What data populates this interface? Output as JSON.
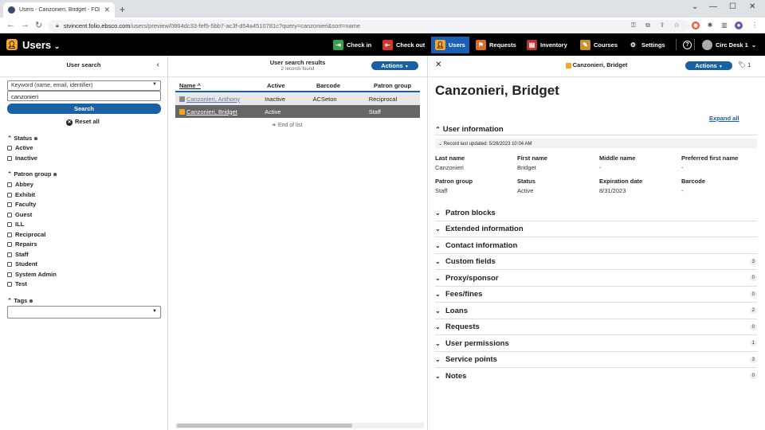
{
  "browser": {
    "tab_title": "Users - Canzonieri, Bridget - FOLIO",
    "url_domain": "stvincent.folio.ebsco.com",
    "url_path": "/users/preview/0864dc33-fef5-5bb7-ac3f-d54a4510781c?query=canzonieri&sort=name"
  },
  "app": {
    "title": "Users",
    "nav": [
      {
        "label": "Check in",
        "color": "#3aa04a"
      },
      {
        "label": "Check out",
        "color": "#d9342b"
      },
      {
        "label": "Users",
        "color": "#f5a623"
      },
      {
        "label": "Requests",
        "color": "#e06c1f"
      },
      {
        "label": "Inventory",
        "color": "#b5342b"
      },
      {
        "label": "Courses",
        "color": "#c8902e"
      },
      {
        "label": "Settings",
        "color": "#000000"
      }
    ],
    "service_point": "Circ Desk 1"
  },
  "search": {
    "header": "User search",
    "dropdown_placeholder": "Keyword (name, email, identifier)",
    "query": "canzonieri",
    "search_label": "Search",
    "reset_label": "Reset all",
    "status_label": "Status",
    "status_options": [
      "Active",
      "Inactive"
    ],
    "patron_group_label": "Patron group",
    "patron_groups": [
      "Abbey",
      "Exhibit",
      "Faculty",
      "Guest",
      "ILL",
      "Reciprocal",
      "Repairs",
      "Staff",
      "Student",
      "System Admin",
      "Test"
    ],
    "tags_label": "Tags"
  },
  "results": {
    "header": "User search results",
    "count": "2 records found",
    "actions_label": "Actions",
    "columns": [
      "Name",
      "Active",
      "Barcode",
      "Patron group"
    ],
    "rows": [
      {
        "name": "Canzonieri, Anthony",
        "active": "Inactive",
        "barcode": "ACSeton",
        "group": "Reciprocal"
      },
      {
        "name": "Canzonieri, Bridget",
        "active": "Active",
        "barcode": "",
        "group": "Staff"
      }
    ],
    "end_label": "End of list"
  },
  "detail": {
    "header": "Canzonieri, Bridget",
    "actions_label": "Actions",
    "tag_count": "1",
    "name": "Canzonieri, Bridget",
    "expand_all": "Expand all",
    "user_info_label": "User information",
    "record_updated": "Record last updated: 5/26/2023 10:04 AM",
    "fields": [
      {
        "label": "Last name",
        "value": "Canzonieri"
      },
      {
        "label": "First name",
        "value": "Bridget"
      },
      {
        "label": "Middle name",
        "value": "-"
      },
      {
        "label": "Preferred first name",
        "value": "-"
      },
      {
        "label": "Patron group",
        "value": "Staff"
      },
      {
        "label": "Status",
        "value": "Active"
      },
      {
        "label": "Expiration date",
        "value": "8/31/2023"
      },
      {
        "label": "Barcode",
        "value": "-"
      }
    ],
    "sections": [
      {
        "label": "Patron blocks",
        "count": ""
      },
      {
        "label": "Extended information",
        "count": ""
      },
      {
        "label": "Contact information",
        "count": ""
      },
      {
        "label": "Custom fields",
        "count": "3"
      },
      {
        "label": "Proxy/sponsor",
        "count": "0"
      },
      {
        "label": "Fees/fines",
        "count": "0"
      },
      {
        "label": "Loans",
        "count": "2"
      },
      {
        "label": "Requests",
        "count": "0"
      },
      {
        "label": "User permissions",
        "count": "1"
      },
      {
        "label": "Service points",
        "count": "3"
      },
      {
        "label": "Notes",
        "count": "0"
      }
    ]
  }
}
